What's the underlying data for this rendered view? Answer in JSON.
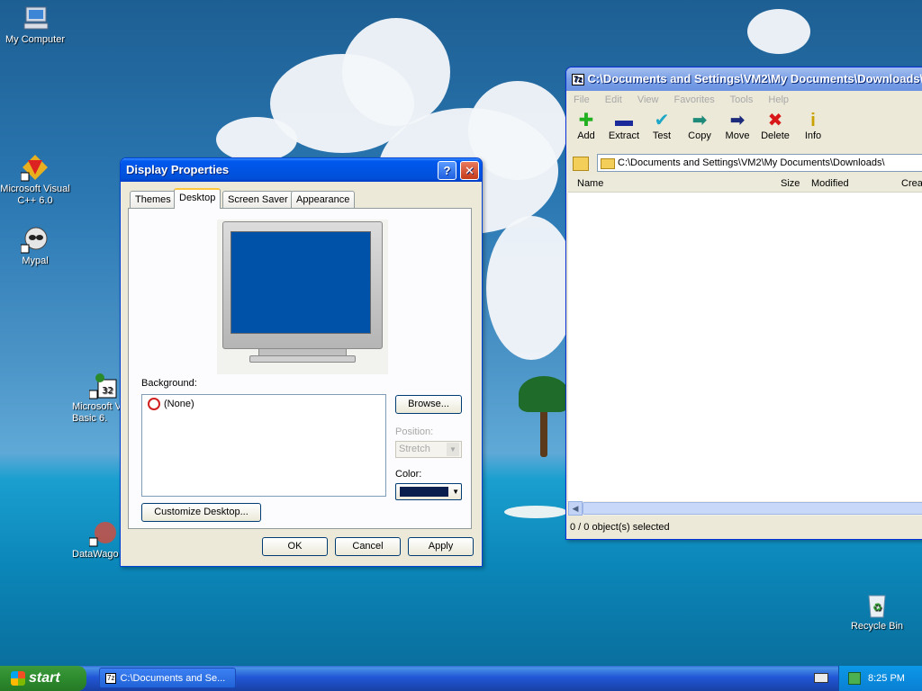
{
  "desktop": {
    "icons": [
      {
        "label": "My Computer"
      },
      {
        "label": "Microsoft Visual C++ 6.0"
      },
      {
        "label": "Mypal"
      },
      {
        "label": "Microsoft V Basic 6."
      },
      {
        "label": "DataWago"
      },
      {
        "label": "Recycle Bin"
      }
    ]
  },
  "display_props": {
    "title": "Display Properties",
    "help_glyph": "?",
    "close_glyph": "✕",
    "tabs": [
      "Themes",
      "Desktop",
      "Screen Saver",
      "Appearance"
    ],
    "active_tab": "Desktop",
    "background_label": "Background:",
    "background_items": [
      "(None)"
    ],
    "browse_label": "Browse...",
    "position_label": "Position:",
    "position_value": "Stretch",
    "color_label": "Color:",
    "color_value": "#0a1f4e",
    "monitor_color": "#0051a8",
    "customize_label": "Customize Desktop...",
    "ok_label": "OK",
    "cancel_label": "Cancel",
    "apply_label": "Apply"
  },
  "sevenzip": {
    "title": "C:\\Documents and Settings\\VM2\\My Documents\\Downloads\\",
    "title_icon": "7z",
    "menu": [
      "File",
      "Edit",
      "View",
      "Favorites",
      "Tools",
      "Help"
    ],
    "toolbar": [
      {
        "label": "Add",
        "icon": "add-icon"
      },
      {
        "label": "Extract",
        "icon": "extract-icon"
      },
      {
        "label": "Test",
        "icon": "test-icon"
      },
      {
        "label": "Copy",
        "icon": "copy-icon"
      },
      {
        "label": "Move",
        "icon": "move-icon"
      },
      {
        "label": "Delete",
        "icon": "delete-icon"
      },
      {
        "label": "Info",
        "icon": "info-icon"
      }
    ],
    "address": "C:\\Documents and Settings\\VM2\\My Documents\\Downloads\\",
    "columns": [
      "Name",
      "Size",
      "Modified",
      "Crea"
    ],
    "status": "0 / 0 object(s) selected"
  },
  "taskbar": {
    "start_label": "start",
    "task_label": "C:\\Documents and Se...",
    "task_icon": "7z",
    "clock": "8:25 PM"
  }
}
